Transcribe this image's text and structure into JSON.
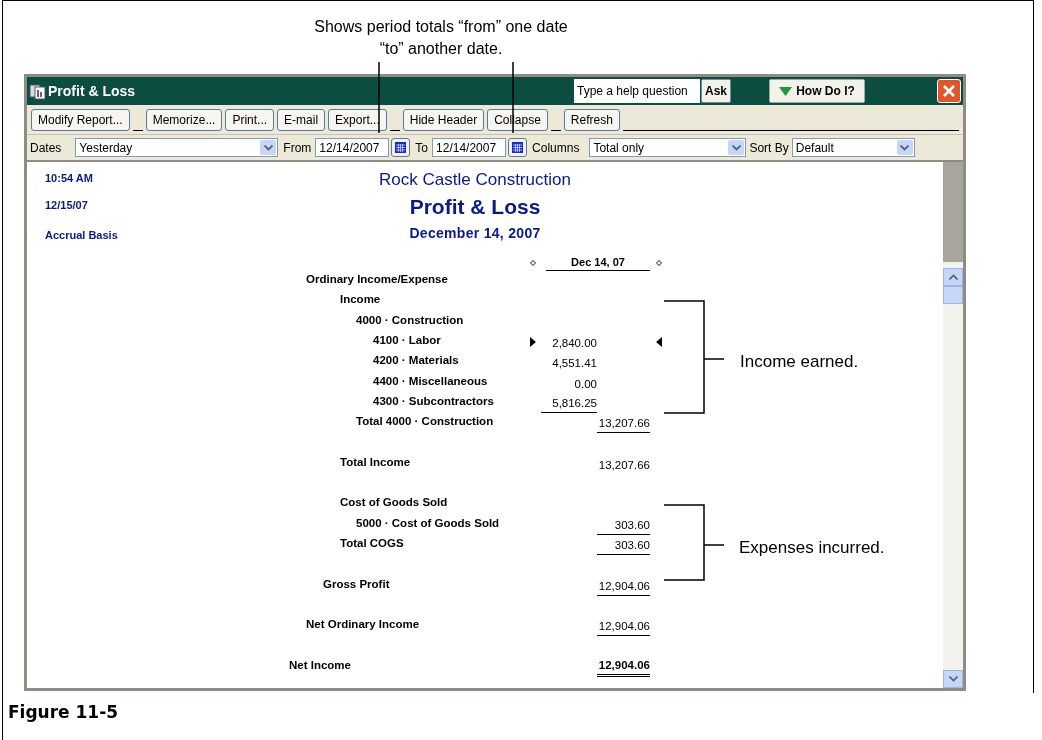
{
  "callouts": {
    "top": "Shows period totals “from” one date “to” another date.",
    "income": "Income earned.",
    "expenses": "Expenses incurred."
  },
  "caption": "Figure 11-5",
  "window": {
    "title": "Profit & Loss",
    "help_placeholder": "Type a help question",
    "ask": "Ask",
    "how_do_i": "How Do I?"
  },
  "toolbar": [
    "Modify Report...",
    "Memorize...",
    "Print...",
    "E-mail",
    "Export...",
    "Hide Header",
    "Collapse",
    "Refresh"
  ],
  "filters": {
    "dates_label": "Dates",
    "dates": "Yesterday",
    "from_label": "From",
    "from": "12/14/2007",
    "to_label": "To",
    "to": "12/14/2007",
    "columns_label": "Columns",
    "columns": "Total only",
    "sort_label": "Sort By",
    "sort": "Default"
  },
  "report": {
    "time": "10:54 AM",
    "date": "12/15/07",
    "basis": "Accrual Basis",
    "company": "Rock Castle Construction",
    "title": "Profit & Loss",
    "period": "December 14, 2007",
    "column": "Dec 14, 07",
    "rows": [
      {
        "label": "Ordinary Income/Expense",
        "kind": "line",
        "selected": false,
        "children": [
          {
            "label": "Income",
            "kind": "line",
            "selected": false,
            "children": [
              {
                "label": "4000 · Construction",
                "kind": "line",
                "selected": false,
                "children": [
                  {
                    "label": "4100 · Labor",
                    "kind": "line",
                    "selected": true,
                    "amount": "2,840.00",
                    "inner": true,
                    "underline": false
                  },
                  {
                    "label": "4200 · Materials",
                    "kind": "line",
                    "selected": false,
                    "amount": "4,551.41",
                    "inner": true,
                    "underline": false
                  },
                  {
                    "label": "4400 · Miscellaneous",
                    "kind": "line",
                    "selected": false,
                    "amount": "0.00",
                    "inner": true,
                    "underline": false
                  },
                  {
                    "label": "4300 · Subcontractors",
                    "kind": "line",
                    "selected": false,
                    "amount": "5,816.25",
                    "inner": true,
                    "underline": true
                  }
                ]
              },
              {
                "label": "Total 4000 · Construction",
                "kind": "line",
                "selected": false,
                "amount": "13,207.66",
                "inner": false,
                "underline": true
              }
            ]
          },
          {
            "label": "Total Income",
            "kind": "line",
            "selected": false,
            "spaced": true,
            "amount": "13,207.66",
            "inner": false,
            "underline": false
          },
          {
            "label": "Cost of Goods Sold",
            "kind": "line",
            "selected": false,
            "spaced": true,
            "children": [
              {
                "label": "5000 · Cost of Goods Sold",
                "kind": "line",
                "selected": false,
                "amount": "303.60",
                "inner": false,
                "underline": true
              }
            ]
          },
          {
            "label": "Total COGS",
            "kind": "line",
            "selected": false,
            "amount": "303.60",
            "inner": false,
            "underline": true
          },
          {
            "label": "Gross Profit",
            "kind": "summary",
            "selected": false,
            "spaced": true,
            "amount": "12,904.06",
            "inner": false,
            "underline": true
          }
        ]
      },
      {
        "label": "Net Ordinary Income",
        "kind": "line",
        "selected": false,
        "spaced": true,
        "amount": "12,904.06",
        "inner": false,
        "underline": true
      },
      {
        "label": "Net Income",
        "kind": "net",
        "selected": false,
        "spaced": true,
        "amount": "12,904.06",
        "inner": false,
        "underline": true
      }
    ]
  }
}
